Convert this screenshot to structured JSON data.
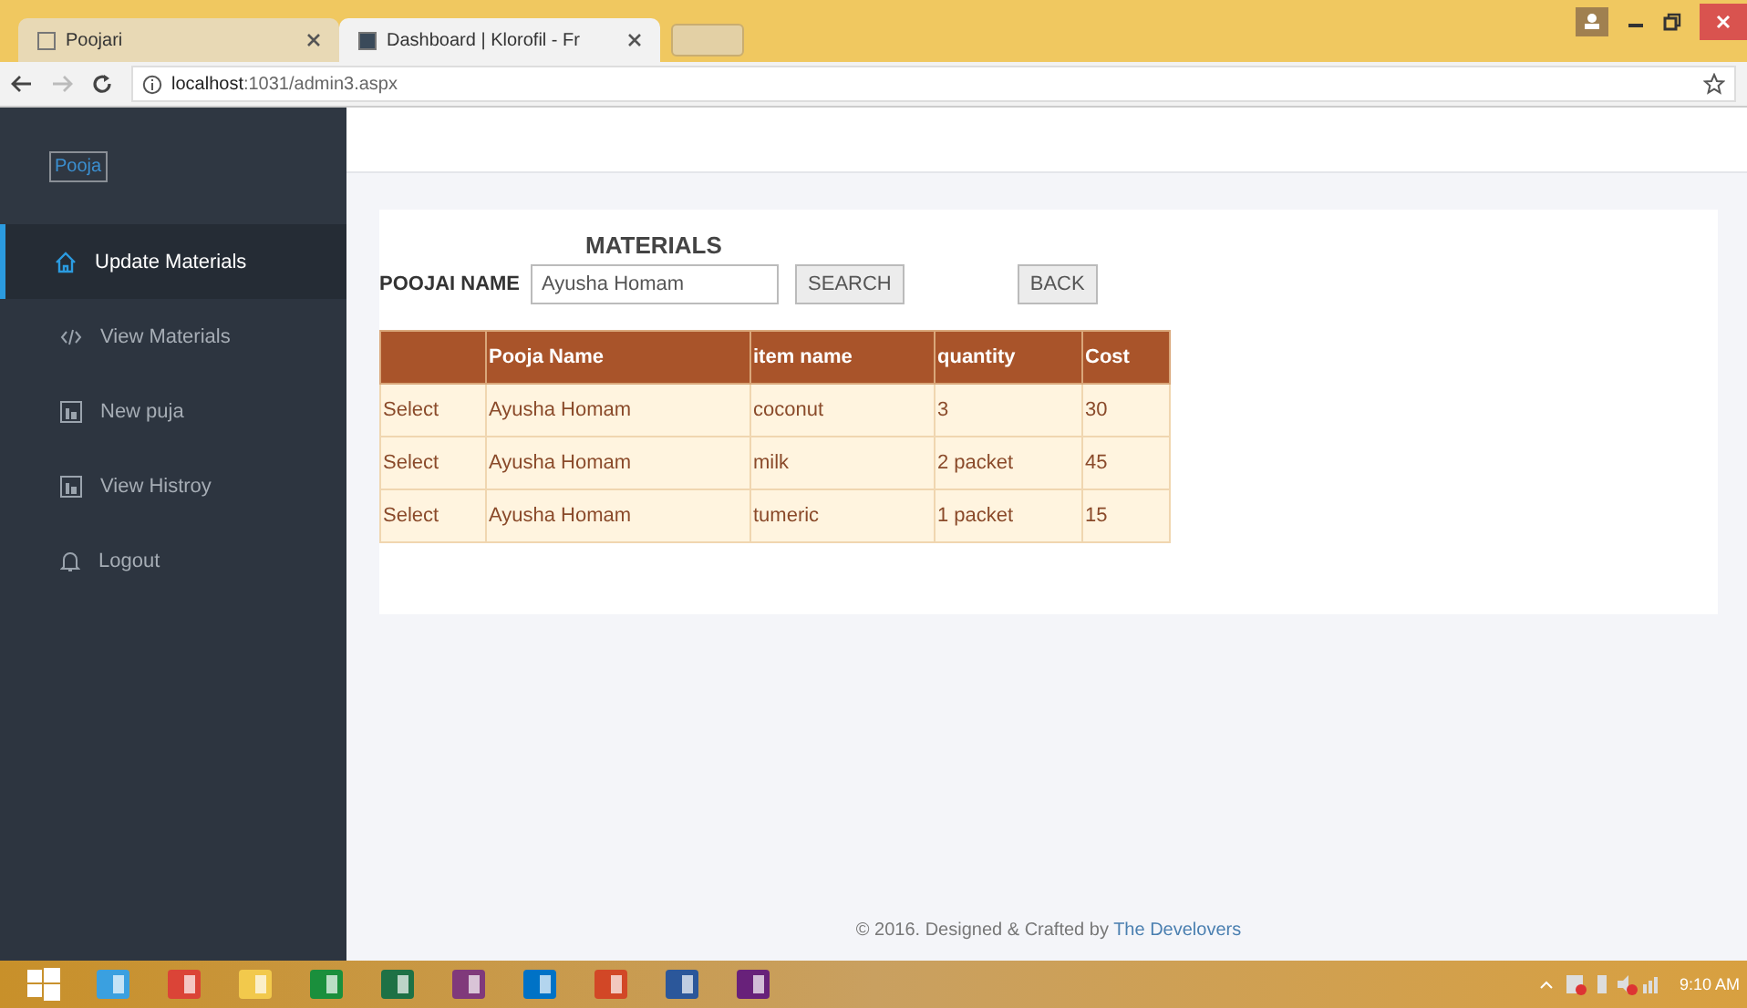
{
  "browser": {
    "tabs": [
      {
        "title": "Poojari",
        "selected": false
      },
      {
        "title": "Dashboard | Klorofil - Fr",
        "selected": true
      }
    ],
    "address": {
      "host": "localhost",
      "path": ":1031/admin3.aspx"
    }
  },
  "sidebar": {
    "brand": "Pooja",
    "items": [
      {
        "label": "Update Materials",
        "kind": "home",
        "selected": true
      },
      {
        "label": "View Materials",
        "kind": "code",
        "selected": false
      },
      {
        "label": "New puja",
        "kind": "chart",
        "selected": false
      },
      {
        "label": "View Histroy",
        "kind": "chart",
        "selected": false
      },
      {
        "label": "Logout",
        "kind": "bell",
        "selected": false
      }
    ]
  },
  "panel": {
    "title": "MATERIALS",
    "field_label": "POOJAI NAME",
    "field_value": "Ayusha Homam",
    "buttons": [
      "SEARCH",
      "BACK"
    ],
    "table": {
      "columns": [
        "",
        "Pooja Name",
        "item name",
        "quantity",
        "Cost"
      ],
      "rows": [
        [
          "Select",
          "Ayusha Homam",
          "coconut",
          "3",
          "30"
        ],
        [
          "Select",
          "Ayusha Homam",
          "milk",
          "2 packet",
          "45"
        ],
        [
          "Select",
          "Ayusha Homam",
          "tumeric",
          "1 packet",
          "15"
        ]
      ]
    }
  },
  "footer": {
    "text": "© 2016. Designed & Crafted by",
    "link": "The Develovers"
  },
  "taskbar": {
    "clock": "9:10 AM"
  }
}
